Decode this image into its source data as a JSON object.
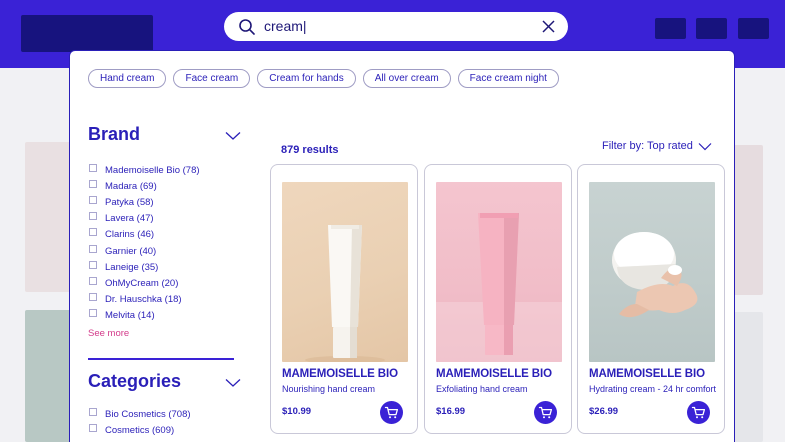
{
  "search": {
    "value": "cream|"
  },
  "chips": [
    "Hand cream",
    "Face cream",
    "Cream for hands",
    "All over cream",
    "Face cream night"
  ],
  "brand_facet": {
    "title": "Brand",
    "items": [
      "Mademoiselle Bio (78)",
      "Madara (69)",
      "Patyka (58)",
      "Lavera (47)",
      "Clarins (46)",
      "Garnier (40)",
      "Laneige (35)",
      "OhMyCream (20)",
      "Dr. Hauschka (18)",
      "Melvita (14)"
    ],
    "see_more": "See more"
  },
  "categories_facet": {
    "title": "Categories",
    "items": [
      "Bio Cosmetics (708)",
      "Cosmetics (609)"
    ]
  },
  "results": {
    "count": "879 results",
    "filter": "Filter by: Top rated"
  },
  "products": [
    {
      "brand": "MAMEMOISELLE BIO",
      "description": "Nourishing hand cream",
      "price": "$10.99"
    },
    {
      "brand": "MAMEMOISELLE BIO",
      "description": "Exfoliating hand cream",
      "price": "$16.99"
    },
    {
      "brand": "MAMEMOISELLE BIO",
      "description": "Hydrating cream - 24 hr comfort",
      "price": "$26.99"
    }
  ],
  "colors": {
    "header": "#3a22d6",
    "accent": "#2a1fb8",
    "link": "#d33b8a"
  },
  "icons": {
    "search": "search-icon",
    "clear": "close-icon",
    "chevron": "chevron-down-icon",
    "cart": "cart-icon"
  }
}
